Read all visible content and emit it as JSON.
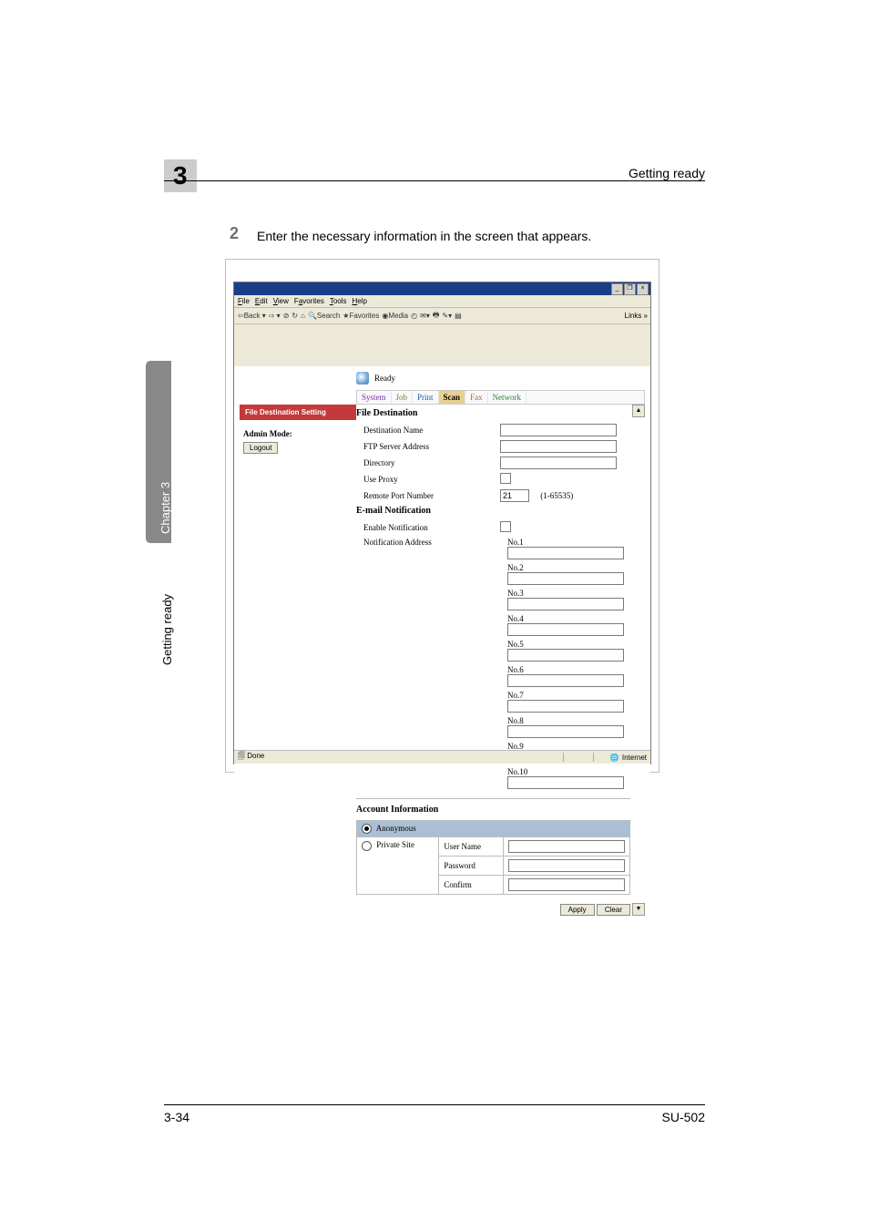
{
  "header": {
    "chapter_number": "3",
    "title": "Getting ready"
  },
  "step": {
    "number": "2",
    "text": "Enter the necessary information in the screen that appears."
  },
  "side_tab": {
    "chapter": "Chapter 3",
    "label": "Getting ready"
  },
  "footer": {
    "page": "3-34",
    "model": "SU-502"
  },
  "browser": {
    "window_buttons": [
      "_",
      "❐",
      "×"
    ],
    "menu": [
      "File",
      "Edit",
      "View",
      "Favorites",
      "Tools",
      "Help"
    ],
    "toolbar": {
      "back": "Back",
      "forward": "→",
      "search": "Search",
      "favorites": "Favorites",
      "media": "Media"
    },
    "links_label": "Links »",
    "status_done": "Done",
    "status_zone": "Internet"
  },
  "config": {
    "ready": "Ready",
    "tabs": {
      "system": "System",
      "job": "Job",
      "print": "Print",
      "scan": "Scan",
      "fax": "Fax",
      "network": "Network"
    },
    "left": {
      "file_dest_setting": "File Destination Setting",
      "admin_mode_label": "Admin Mode:",
      "logout": "Logout"
    },
    "fd": {
      "heading": "File Destination",
      "dest_name": "Destination Name",
      "ftp_server": "FTP Server Address",
      "directory": "Directory",
      "use_proxy": "Use Proxy",
      "remote_port": "Remote Port Number",
      "remote_port_value": "21",
      "remote_port_range": "(1-65535)"
    },
    "email": {
      "heading": "E-mail Notification",
      "enable": "Enable Notification",
      "addr_label": "Notification Address",
      "numbers": [
        "No.1",
        "No.2",
        "No.3",
        "No.4",
        "No.5",
        "No.6",
        "No.7",
        "No.8",
        "No.9",
        "No.10"
      ]
    },
    "account": {
      "heading": "Account Information",
      "anonymous": "Anonymous",
      "private_site": "Private Site",
      "user_name": "User Name",
      "password": "Password",
      "confirm": "Confirm"
    },
    "buttons": {
      "apply": "Apply",
      "clear": "Clear"
    }
  }
}
